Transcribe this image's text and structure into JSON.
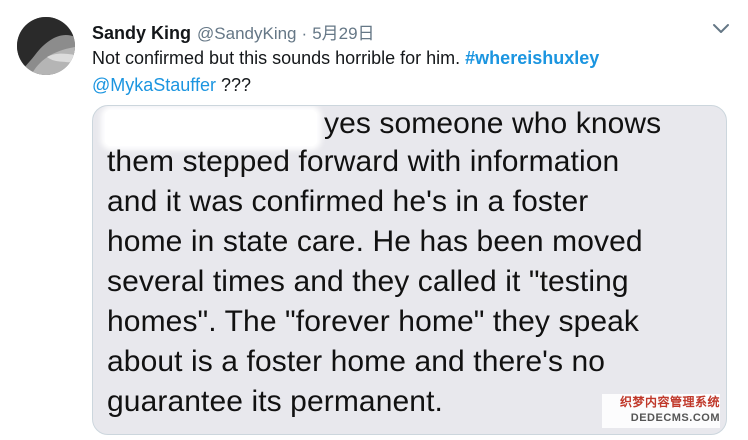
{
  "tweet": {
    "author_name": "Sandy King",
    "author_handle": "@SandyKing",
    "separator": "·",
    "date": "5月29日",
    "text_before_hashtag": "Not confirmed but this sounds horrible for him. ",
    "hashtag": "#whereishuxley",
    "mention": "@MykaStauffer",
    "text_after_mention": " ???"
  },
  "media": {
    "lines": [
      "yes someone who knows",
      "them stepped forward with information",
      "and it was confirmed he's in a foster",
      "home in state care. He has been moved",
      "several times and they called it \"testing",
      "homes\". The \"forever home\" they speak",
      "about is a foster home and there's no",
      "guarantee its permanent."
    ]
  },
  "watermark": {
    "line1": "织梦内容管理系统",
    "line2": "DEDECMS.COM"
  },
  "icons": {
    "avatar": "user-avatar",
    "caret": "chevron-down-icon"
  },
  "colors": {
    "link": "#1b95e0",
    "secondary_text": "#657786",
    "card_background": "#e8e8ed",
    "card_border": "#ccd6dd"
  }
}
